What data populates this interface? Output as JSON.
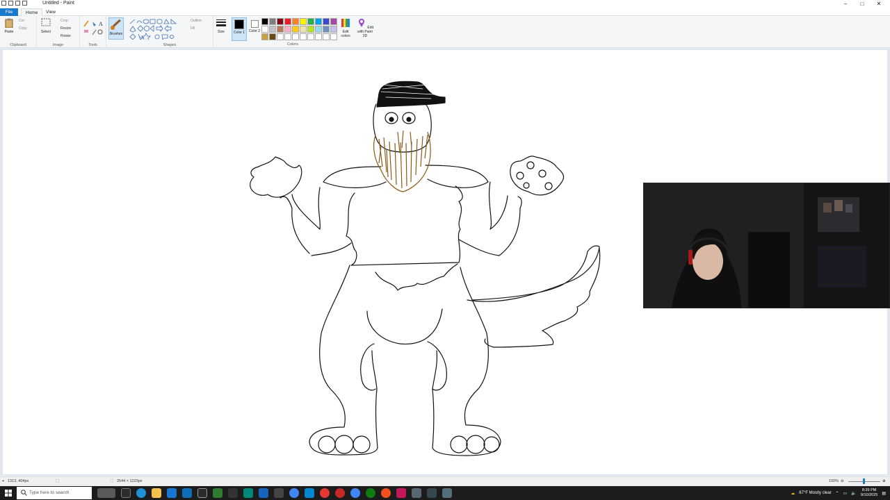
{
  "window": {
    "title": "Untitled - Paint"
  },
  "menu": {
    "file": "File",
    "home": "Home",
    "view": "View"
  },
  "ribbon": {
    "clipboard": {
      "label": "Clipboard",
      "paste": "Paste",
      "cut": "Cut",
      "copy": "Copy"
    },
    "image": {
      "label": "Image",
      "select": "Select",
      "crop": "Crop",
      "resize": "Resize",
      "rotate": "Rotate"
    },
    "tools": {
      "label": "Tools"
    },
    "brushes": "Brushes",
    "shapes": {
      "label": "Shapes",
      "outline": "Outline",
      "fill": "Fill"
    },
    "size": "Size",
    "color1": "Color 1",
    "color2": "Color 2",
    "colors": {
      "label": "Colors",
      "edit": "Edit colors",
      "paint3d": "Edit with Paint 3D"
    },
    "palette": [
      "#000000",
      "#7f7f7f",
      "#880015",
      "#ed1c24",
      "#ff7f27",
      "#fff200",
      "#22b14c",
      "#00a2e8",
      "#3f48cc",
      "#a349a4",
      "#ffffff",
      "#c3c3c3",
      "#b97a57",
      "#ffaec9",
      "#ffc90e",
      "#efe4b0",
      "#b5e61d",
      "#99d9ea",
      "#7092be",
      "#c8bfe7",
      "#c8a03c",
      "#6b4a12",
      "#ffffff",
      "#ffffff",
      "#ffffff",
      "#ffffff",
      "#ffffff",
      "#ffffff",
      "#ffffff",
      "#ffffff"
    ]
  },
  "status": {
    "cursor": "1313, 404px",
    "size": "2544 × 1223px",
    "zoom": "100%"
  },
  "taskbar": {
    "search_placeholder": "Type here to search",
    "weather": "67°F  Mostly clear",
    "time": "8:39 PM",
    "date": "9/10/2025"
  }
}
